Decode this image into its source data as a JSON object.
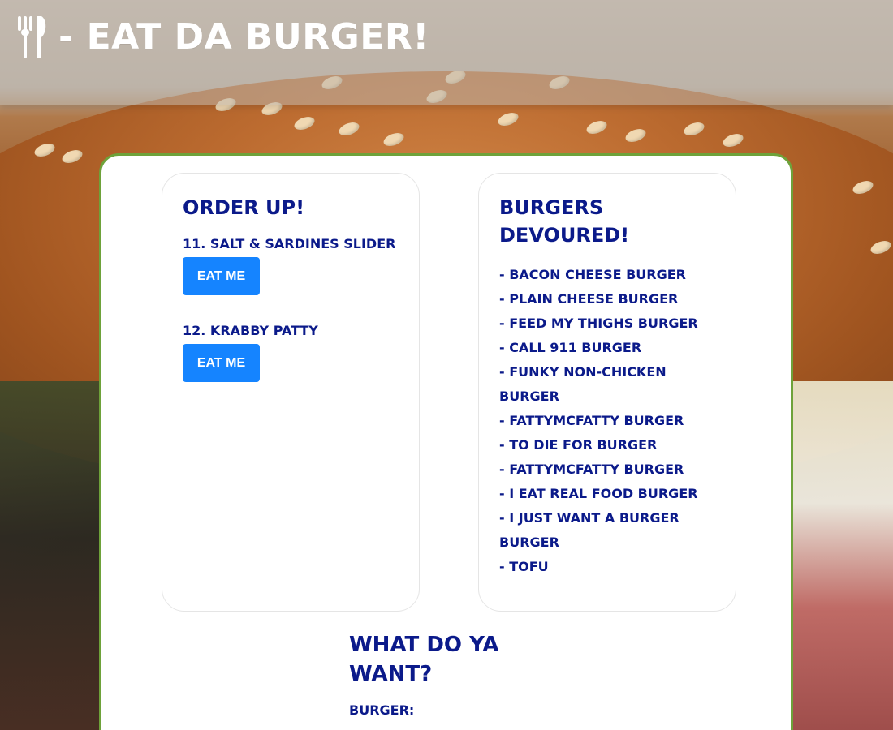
{
  "header": {
    "title": "- EAT DA BURGER!",
    "icon": "utensils-icon"
  },
  "order_up": {
    "title": "ORDER UP!",
    "items": [
      {
        "label": "11. SALT & SARDINES SLIDER",
        "button": "EAT ME"
      },
      {
        "label": "12. KRABBY PATTY",
        "button": "EAT ME"
      }
    ]
  },
  "devoured": {
    "title": "BURGERS DEVOURED!",
    "items": [
      "- BACON CHEESE BURGER",
      "- PLAIN CHEESE BURGER",
      "- FEED MY THIGHS BURGER",
      "- CALL 911 BURGER",
      "- FUNKY NON-CHICKEN BURGER",
      "- FATTYMCFATTY BURGER",
      "- TO DIE FOR BURGER",
      "- FATTYMCFATTY BURGER",
      "- I EAT REAL FOOD BURGER",
      "- I JUST WANT A BURGER BURGER",
      "- TOFU"
    ]
  },
  "form": {
    "title": "WHAT DO YA WANT?",
    "label": "BURGER:",
    "value": "",
    "placeholder": ""
  },
  "colors": {
    "accent": "#1584ff",
    "text": "#0b1a8a",
    "panel_border": "#6ea23a"
  }
}
